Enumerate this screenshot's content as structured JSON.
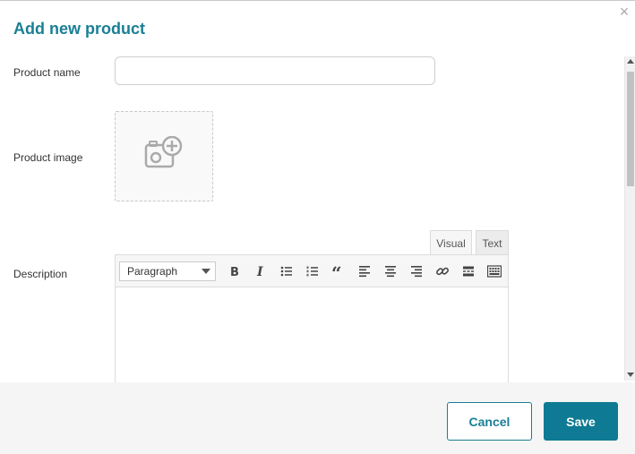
{
  "dialog": {
    "title": "Add new product",
    "close_glyph": "×"
  },
  "fields": {
    "product_name": {
      "label": "Product name",
      "value": "",
      "placeholder": ""
    },
    "product_image": {
      "label": "Product image",
      "icon": "camera-plus-icon"
    },
    "description": {
      "label": "Description",
      "value": ""
    }
  },
  "editor": {
    "tabs": [
      {
        "label": "Visual",
        "active": true
      },
      {
        "label": "Text",
        "active": false
      }
    ],
    "format_select": "Paragraph",
    "toolbar_buttons": [
      "bold-icon",
      "italic-icon",
      "bullet-list-icon",
      "numbered-list-icon",
      "blockquote-icon",
      "align-left-icon",
      "align-center-icon",
      "align-right-icon",
      "link-icon",
      "read-more-icon",
      "toolbar-toggle-icon"
    ]
  },
  "footer": {
    "cancel_label": "Cancel",
    "save_label": "Save"
  },
  "colors": {
    "accent": "#1a7f95",
    "primary_button": "#0e7a93",
    "footer_bg": "#f5f5f5"
  }
}
